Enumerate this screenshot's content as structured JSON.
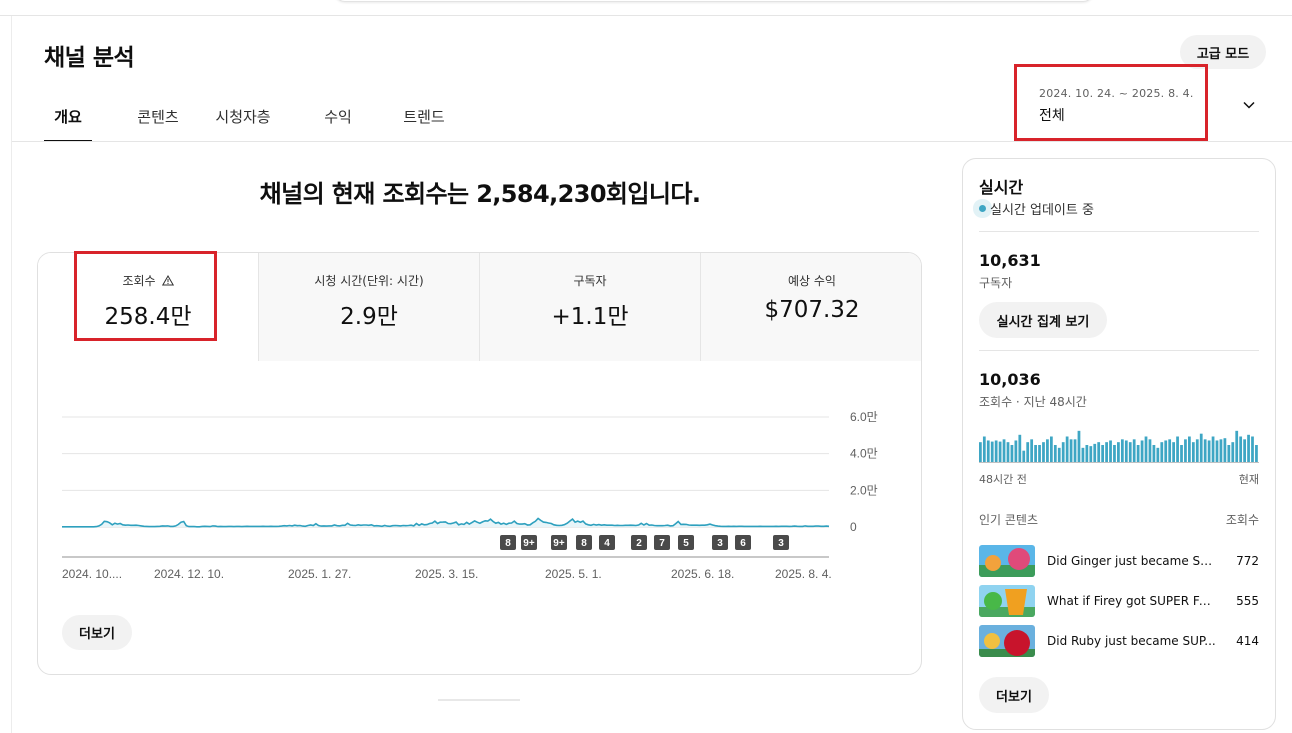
{
  "header": {
    "title": "채널 분석",
    "advanced_mode_label": "고급 모드"
  },
  "tabs": [
    {
      "label": "개요",
      "active": true
    },
    {
      "label": "콘텐츠",
      "active": false
    },
    {
      "label": "시청자층",
      "active": false
    },
    {
      "label": "수익",
      "active": false
    },
    {
      "label": "트렌드",
      "active": false
    }
  ],
  "date_selector": {
    "range": "2024. 10. 24. ~ 2025. 8. 4.",
    "label": "전체",
    "icon": "chevron-down-icon"
  },
  "headline": "채널의 현재 조회수는 2,584,230회입니다.",
  "metrics": [
    {
      "label": "조회수",
      "value": "258.4만",
      "warning": true
    },
    {
      "label": "시청 시간(단위: 시간)",
      "value": "2.9만"
    },
    {
      "label": "구독자",
      "value": "+1.1만"
    },
    {
      "label": "예상 수익",
      "value": "$707.32"
    }
  ],
  "chart_data": {
    "type": "area",
    "x": [
      "2024. 10....",
      "2024. 12. 10.",
      "2025. 1. 27.",
      "2025. 3. 15.",
      "2025. 5. 1.",
      "2025. 6. 18.",
      "2025. 8. 4."
    ],
    "y_ticks": [
      "6.0만",
      "4.0만",
      "2.0만",
      "0"
    ],
    "ylim": [
      0,
      60000
    ],
    "grid": true,
    "series": [
      {
        "values": [
          100,
          100,
          100,
          100,
          100,
          100,
          100,
          100,
          100,
          100,
          100,
          100,
          100,
          200,
          600,
          1500,
          3100,
          2900,
          2300,
          1200,
          2100,
          1600,
          1900,
          1200,
          1000,
          1100,
          900,
          900,
          1000,
          800,
          600,
          400,
          300,
          200,
          200,
          200,
          300,
          400,
          600,
          500,
          600,
          300,
          300,
          600,
          1400,
          2600,
          3000,
          700,
          200,
          200,
          200,
          100,
          100,
          300,
          400,
          300,
          200,
          600,
          500,
          200,
          300,
          200,
          200,
          300,
          300,
          200,
          300,
          300,
          200,
          300,
          400,
          300,
          300,
          300,
          300,
          300,
          400,
          300,
          300,
          400,
          300,
          300,
          400,
          500,
          700,
          600,
          800,
          600,
          1000,
          700,
          800,
          500,
          400,
          800,
          1100,
          800,
          1800,
          800,
          500,
          600,
          500,
          600,
          600,
          1100,
          700,
          600,
          900,
          900,
          2000,
          1100,
          900,
          800,
          1200,
          900,
          1100,
          1100,
          900,
          1200,
          600,
          700,
          600,
          400,
          800,
          500,
          400,
          700,
          800,
          700,
          600,
          800,
          700,
          800,
          1000,
          600,
          1900,
          900,
          1700,
          1200,
          1300,
          1900,
          2200,
          3200,
          1900,
          2600,
          2700,
          2800,
          1900,
          1800,
          2200,
          2700,
          1200,
          1700,
          1400,
          2500,
          1600,
          2400,
          3300,
          2600,
          2100,
          2800,
          3400,
          3200,
          4300,
          3000,
          2100,
          2500,
          1600,
          2100,
          1400,
          2100,
          2200,
          3200,
          1900,
          1600,
          1600,
          1800,
          1100,
          1200,
          2300,
          3100,
          4700,
          3600,
          2700,
          2500,
          2200,
          1900,
          1200,
          900,
          800,
          900,
          1300,
          2100,
          3200,
          4300,
          2600,
          3200,
          2600,
          3200,
          1700,
          1200,
          900,
          1400,
          1100,
          1300,
          1000,
          1200,
          1000,
          1000,
          1000,
          800,
          900,
          800,
          800,
          900,
          900,
          1000,
          900,
          800,
          1100,
          2000,
          1100,
          1900,
          1000,
          1100,
          800,
          700,
          700,
          700,
          800,
          1000,
          600,
          700,
          1800,
          3000,
          1400,
          1500,
          1400,
          1100,
          1000,
          1000,
          1000,
          900,
          1000,
          1000,
          1200,
          1600,
          1100,
          700,
          500,
          400,
          300,
          300,
          400,
          300,
          400,
          300,
          400,
          400,
          300,
          300,
          300,
          300,
          300,
          300,
          400,
          300,
          300,
          300,
          300,
          300,
          400,
          300,
          400,
          400,
          400,
          300,
          400,
          500,
          400,
          300,
          300,
          600,
          400,
          400,
          400,
          500,
          500,
          400,
          400,
          500,
          400
        ]
      }
    ],
    "markers": [
      "8",
      "9+",
      "9+",
      "8",
      "4",
      "2",
      "7",
      "5",
      "3",
      "6",
      "3"
    ]
  },
  "more_label": "더보기",
  "realtime": {
    "title": "실시간",
    "status": "실시간 업데이트 중",
    "subscribers_value": "10,631",
    "subscribers_label": "구독자",
    "realtime_button": "실시간 집계 보기",
    "views_value": "10,036",
    "views_label": "조회수 · 지난 48시간",
    "bars": [
      35,
      45,
      38,
      36,
      38,
      36,
      40,
      35,
      30,
      38,
      48,
      20,
      35,
      40,
      30,
      30,
      35,
      40,
      45,
      30,
      25,
      35,
      45,
      40,
      40,
      55,
      25,
      30,
      28,
      32,
      35,
      30,
      35,
      38,
      30,
      35,
      40,
      38,
      35,
      40,
      30,
      38,
      45,
      40,
      30,
      25,
      35,
      38,
      40,
      35,
      45,
      30,
      40,
      45,
      35,
      40,
      50,
      40,
      38,
      45,
      38,
      40,
      42,
      30,
      35,
      55,
      45,
      40,
      48,
      45,
      30
    ],
    "axis_left": "48시간 전",
    "axis_right": "현재",
    "popular_header": "인기 콘텐츠",
    "popular_count_header": "조회수",
    "popular": [
      {
        "title": "Did Ginger just became SU...",
        "count": "772"
      },
      {
        "title": "What if Firey got SUPER FA...",
        "count": "555"
      },
      {
        "title": "Did Ruby just became SUP...",
        "count": "414"
      }
    ],
    "more_label": "더보기"
  },
  "colors": {
    "accent": "#3ea6c4",
    "highlight": "#d8232a"
  }
}
